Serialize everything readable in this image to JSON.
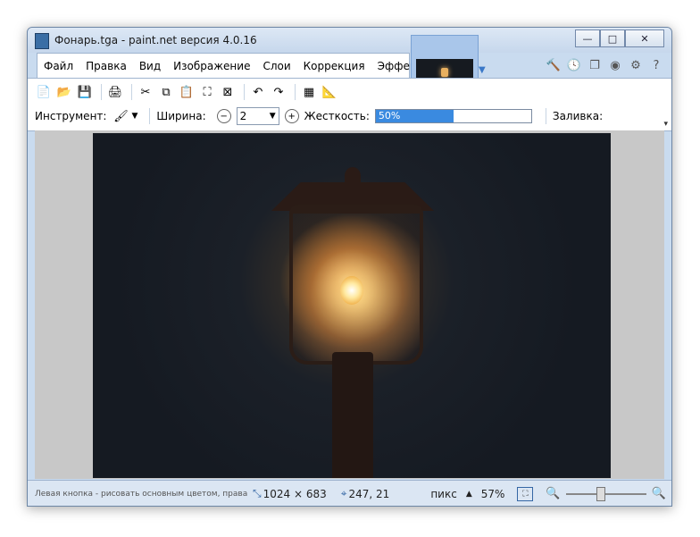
{
  "window": {
    "title": "Фонарь.tga - paint.net версия 4.0.16",
    "controls": {
      "minimize": "—",
      "maximize": "□",
      "close": "✕"
    }
  },
  "menu": {
    "items": [
      "Файл",
      "Правка",
      "Вид",
      "Изображение",
      "Слои",
      "Коррекция",
      "Эффекты"
    ]
  },
  "toolbar": {
    "buttons": [
      {
        "name": "new-icon",
        "glyph": "📄"
      },
      {
        "name": "open-icon",
        "glyph": "📂"
      },
      {
        "name": "save-icon",
        "glyph": "💾"
      },
      {
        "name": "print-icon",
        "glyph": "🖨"
      },
      {
        "name": "cut-icon",
        "glyph": "✂"
      },
      {
        "name": "copy-icon",
        "glyph": "⧉"
      },
      {
        "name": "paste-icon",
        "glyph": "📋"
      },
      {
        "name": "crop-icon",
        "glyph": "⛶"
      },
      {
        "name": "deselect-icon",
        "glyph": "⊠"
      },
      {
        "name": "undo-icon",
        "glyph": "↶"
      },
      {
        "name": "redo-icon",
        "glyph": "↷"
      },
      {
        "name": "grid-icon",
        "glyph": "▦"
      },
      {
        "name": "ruler-icon",
        "glyph": "📐"
      }
    ]
  },
  "options": {
    "tool_label": "Инструмент:",
    "width_label": "Ширина:",
    "width_value": "2",
    "hardness_label": "Жесткость:",
    "hardness_value": "50%",
    "hardness_fraction": 0.5,
    "fill_label": "Заливка:"
  },
  "status": {
    "hint": "Левая кнопка - рисовать основным цветом, правая кнопка - исполь...",
    "image_size": "1024 × 683",
    "cursor_pos": "247, 21",
    "units": "пикс",
    "zoom": "57%"
  },
  "colors": {
    "accent": "#3a8ae0",
    "window_bg": "#c9dbef"
  }
}
